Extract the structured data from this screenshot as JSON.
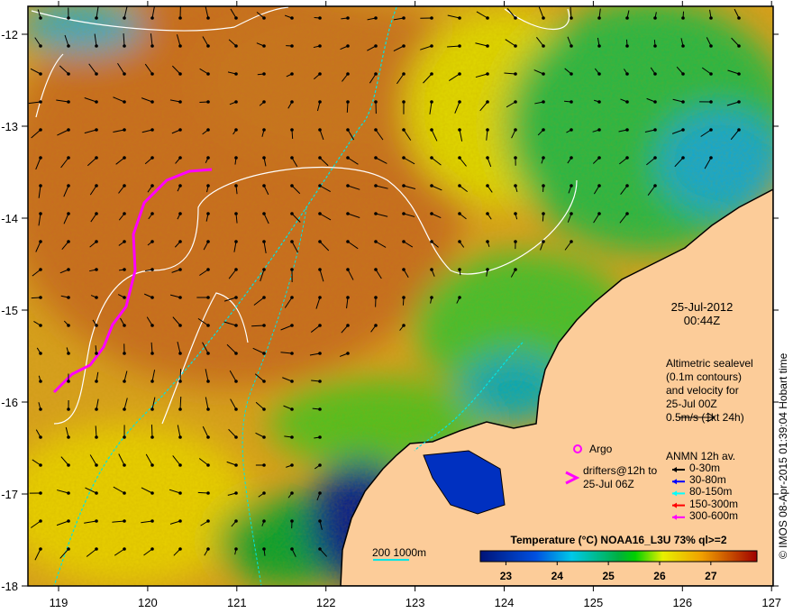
{
  "map": {
    "x_ticks": [
      "119",
      "120",
      "121",
      "122",
      "123",
      "124",
      "125",
      "126",
      "127"
    ],
    "y_ticks": [
      "-12",
      "-13",
      "-14",
      "-15",
      "-16",
      "-17",
      "-18"
    ],
    "colors": {
      "land": "#fccc99",
      "warm": "#c8641e",
      "mid": "#e8c800",
      "cool": "#00b450",
      "cold": "#001e8c",
      "contour": "#ffffff",
      "isobath": "#00e5e5",
      "drifter": "#ff00ff"
    }
  },
  "datetime": {
    "date": "25-Jul-2012",
    "time": "00:44Z"
  },
  "altimetry": {
    "lines": [
      "Altimetric sealevel",
      "(0.1m contours)",
      "and velocity for",
      "25-Jul 00Z",
      "0.5m/s (1kt 24h)"
    ]
  },
  "argo": {
    "label": "Argo"
  },
  "drifters": {
    "lines": [
      "drifters@12h to",
      "25-Jul 06Z"
    ]
  },
  "anmn": {
    "title": "ANMN 12h av.",
    "items": [
      {
        "label": "0-30m",
        "color": "#000000"
      },
      {
        "label": "30-80m",
        "color": "#0000ff"
      },
      {
        "label": "80-150m",
        "color": "#00ffff"
      },
      {
        "label": "150-300m",
        "color": "#ff0000"
      },
      {
        "label": "300-600m",
        "color": "#ff00ff"
      }
    ]
  },
  "isobath_legend": {
    "label": "200  1000m"
  },
  "colorbar": {
    "title": "Temperature (°C) NOAA16_L3U 73% ql>=2",
    "ticks": [
      "23",
      "24",
      "25",
      "26",
      "27"
    ],
    "range": [
      22.5,
      27.9
    ]
  },
  "credit": "© IMOS 08-Apr-2015 01:39:04 Hobart time"
}
